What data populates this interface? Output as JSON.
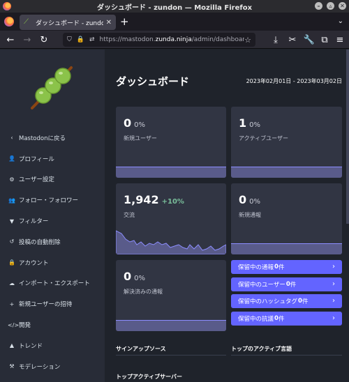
{
  "window": {
    "title": "ダッシュボード - zundon — Mozilla Firefox"
  },
  "tab": {
    "title": "ダッシュボード - zundon",
    "close": "✕",
    "new": "+"
  },
  "url": {
    "host_prefix": "https://mastodon.",
    "host": "zunda.ninja",
    "path": "/admin/dashboard"
  },
  "icons": [
    "firefox-icon",
    "back-icon",
    "forward-icon",
    "reload-icon",
    "shield-icon",
    "lock-icon",
    "permissions-icon",
    "star-icon",
    "download-icon",
    "screenshot-icon",
    "wrench-icon",
    "extensions-icon",
    "menu-icon"
  ],
  "sidebar": {
    "items": [
      {
        "label": "Mastodonに戻る",
        "icon": "‹"
      },
      {
        "label": "プロフィール",
        "icon": "👤"
      },
      {
        "label": "ユーザー設定",
        "icon": "⚙"
      },
      {
        "label": "フォロー・フォロワー",
        "icon": "👥"
      },
      {
        "label": "フィルター",
        "icon": "▼"
      },
      {
        "label": "投稿の自動削除",
        "icon": "↺"
      },
      {
        "label": "アカウント",
        "icon": "🔒"
      },
      {
        "label": "インポート・エクスポート",
        "icon": "☁"
      },
      {
        "label": "新規ユーザーの招待",
        "icon": "+"
      },
      {
        "label": "開発",
        "icon": "</>"
      },
      {
        "label": "トレンド",
        "icon": "▲"
      },
      {
        "label": "モデレーション",
        "icon": "⚒"
      }
    ]
  },
  "main": {
    "title": "ダッシュボード",
    "date_range": "2023年02月01日 - 2023年03月02日",
    "cards": [
      {
        "value": "0",
        "pct": "0%",
        "label": "新規ユーザー"
      },
      {
        "value": "1",
        "pct": "0%",
        "label": "アクティブユーザー"
      },
      {
        "value": "1,942",
        "pct": "+10%",
        "label": "交流"
      },
      {
        "value": "0",
        "pct": "0%",
        "label": "新規通報"
      },
      {
        "value": "0",
        "pct": "0%",
        "label": "解決済みの通報"
      }
    ],
    "pending": [
      {
        "label": "保留中の通報 ",
        "count": "0",
        "suffix": "件"
      },
      {
        "label": "保留中のユーザー ",
        "count": "0",
        "suffix": "件"
      },
      {
        "label": "保留中のハッシュタグ ",
        "count": "0",
        "suffix": "件"
      },
      {
        "label": "保留中の抗議 ",
        "count": "0",
        "suffix": "件"
      }
    ],
    "sections": {
      "signup_sources": "サインアップソース",
      "top_languages": "トップのアクティブ言語",
      "top_servers": "トップアクティブサーバー"
    }
  },
  "colors": {
    "accent": "#6364ff",
    "sidebar": "#282c37",
    "background": "#1f232b",
    "card": "#313543",
    "positive": "#79bd9a"
  }
}
